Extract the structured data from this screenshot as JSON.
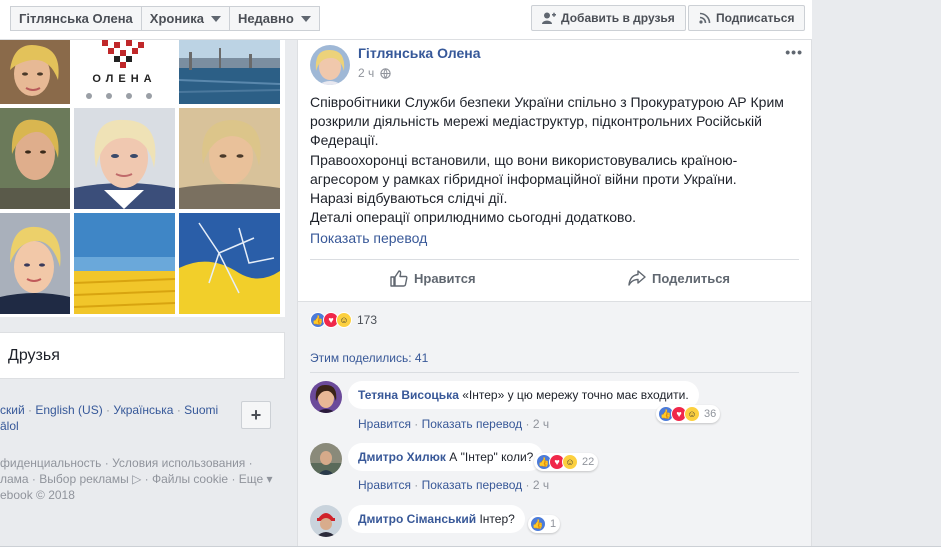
{
  "breadcrumbs": [
    {
      "label": "Гітлянська Олена"
    },
    {
      "label": "Хроника"
    },
    {
      "label": "Недавно"
    }
  ],
  "header_actions": {
    "add_friend": "Добавить в друзья",
    "subscribe": "Подписаться"
  },
  "photos": {
    "name_caption": "ОЛЕНА"
  },
  "friends_card": {
    "title": "Друзья"
  },
  "languages": {
    "l1": "ский",
    "l2": "English (US)",
    "l3": "Українська",
    "l4": "Suomi",
    "l5": "ālol",
    "plus": "+"
  },
  "footer": {
    "line1": "фиденциальность · Условия использования ·",
    "line2": "лама · Выбор рекламы ▷ · Файлы cookie · Еще ▾",
    "line3": "ebook © 2018"
  },
  "post": {
    "author": "Гітлянська Олена",
    "time": "2 ч",
    "more": "•••",
    "paragraphs": [
      "Співробітники Служби безпеки України спільно з Прокуратурою АР Крим розкрили діяльність мережі медіаструктур, підконтрольних Російській Федерації.",
      "Правоохоронці встановили, що вони використовувались країною-агресором у рамках гібридної інформаційної війни проти України.",
      "Наразі відбуваються слідчі дії.",
      "Деталі операції оприлюднимо сьогодні додатково."
    ],
    "translate": "Показать перевод",
    "like_label": "Нравится",
    "share_label": "Поделиться",
    "reaction_count": "173",
    "shared_label": "Этим поделились: 41"
  },
  "comments": [
    {
      "name": "Тетяна Висоцька",
      "text": "«Інтер» у цю мережу точно має входити.",
      "like": "Нравится",
      "translate": "Показать перевод",
      "time": "2 ч",
      "reactions": "36"
    },
    {
      "name": "Дмитро Хилюк",
      "text": "А \"Інтер\" коли?",
      "like": "Нравится",
      "translate": "Показать перевод",
      "time": "2 ч",
      "reactions": "22"
    },
    {
      "name": "Дмитро Сіманський",
      "text": "Інтер?",
      "reactions": "1"
    }
  ],
  "colors": {
    "link": "#385898",
    "like": "#4c7bd9",
    "love": "#f0284a",
    "haha": "#fcd03f",
    "page_bg": "#e9ebee"
  }
}
